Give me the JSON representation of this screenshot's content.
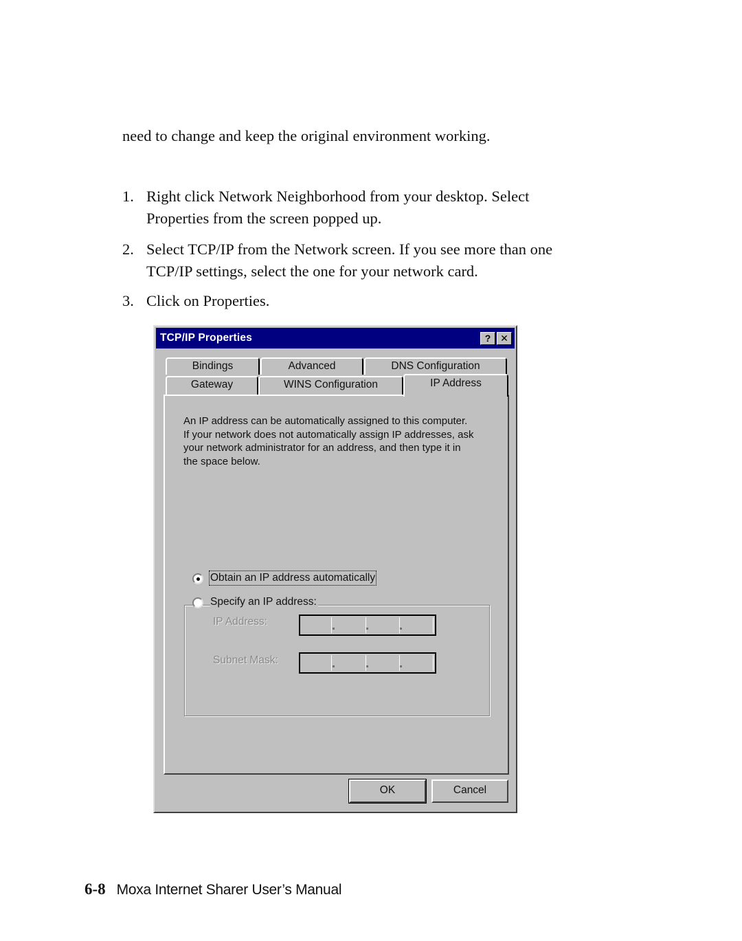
{
  "document": {
    "intro_text": "need to change and keep the original environment working.",
    "steps": [
      {
        "number": "1.",
        "lines": [
          "Right click Network Neighborhood from your desktop. Select",
          "Properties from the screen popped up."
        ]
      },
      {
        "number": "2.",
        "lines": [
          "Select TCP/IP from the Network screen. If you see more than one",
          "TCP/IP settings, select the one for your network card."
        ]
      },
      {
        "number": "3.",
        "lines": [
          "Click on Properties."
        ]
      }
    ],
    "footer": {
      "page_number": "6-8",
      "manual_title": "Moxa Internet Sharer User’s Manual"
    }
  },
  "dialog": {
    "title": "TCP/IP Properties",
    "title_bar_color": "#000080",
    "help_button": "?",
    "close_button": "✕",
    "tabs_row_back": [
      "Bindings",
      "Advanced",
      "DNS Configuration"
    ],
    "tabs_row_front": [
      "Gateway",
      "WINS Configuration",
      "IP Address"
    ],
    "active_tab": "IP Address",
    "description_lines": [
      "An IP address can be automatically assigned to this computer.",
      "If your network does not automatically assign IP addresses, ask",
      "your network administrator for an address, and then type it in",
      "the space below."
    ],
    "radio_auto": {
      "label": "Obtain an IP address automatically",
      "checked": true
    },
    "radio_specify": {
      "label": "Specify an IP address:",
      "checked": false
    },
    "ip_address": {
      "label": "IP Address:",
      "octets": [
        "",
        "",
        "",
        ""
      ],
      "enabled": false
    },
    "subnet_mask": {
      "label": "Subnet Mask:",
      "octets": [
        "",
        "",
        "",
        ""
      ],
      "enabled": false
    },
    "ok_label": "OK",
    "cancel_label": "Cancel"
  }
}
